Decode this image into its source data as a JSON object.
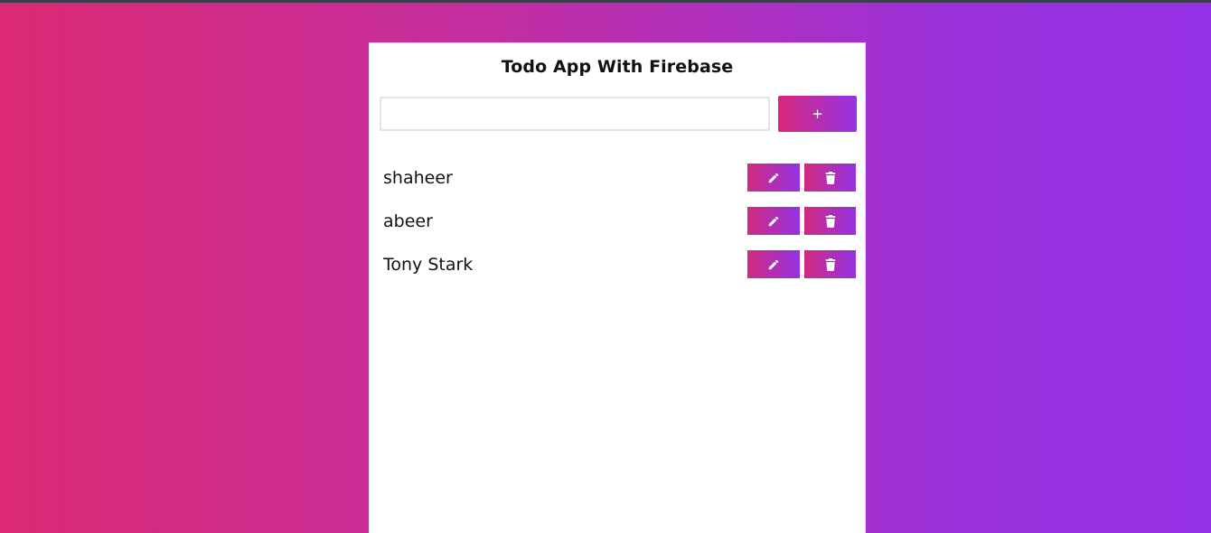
{
  "app": {
    "title": "Todo App With Firebase"
  },
  "input": {
    "value": "",
    "placeholder": ""
  },
  "add_button": {
    "label": "+"
  },
  "todos": [
    {
      "text": "shaheer"
    },
    {
      "text": "abeer"
    },
    {
      "text": "Tony Stark"
    }
  ],
  "icons": {
    "edit": "pencil-icon",
    "delete": "trash-icon"
  },
  "colors": {
    "gradient_start": "#dc2a74",
    "gradient_end": "#9531e6",
    "card_background": "#ffffff"
  }
}
